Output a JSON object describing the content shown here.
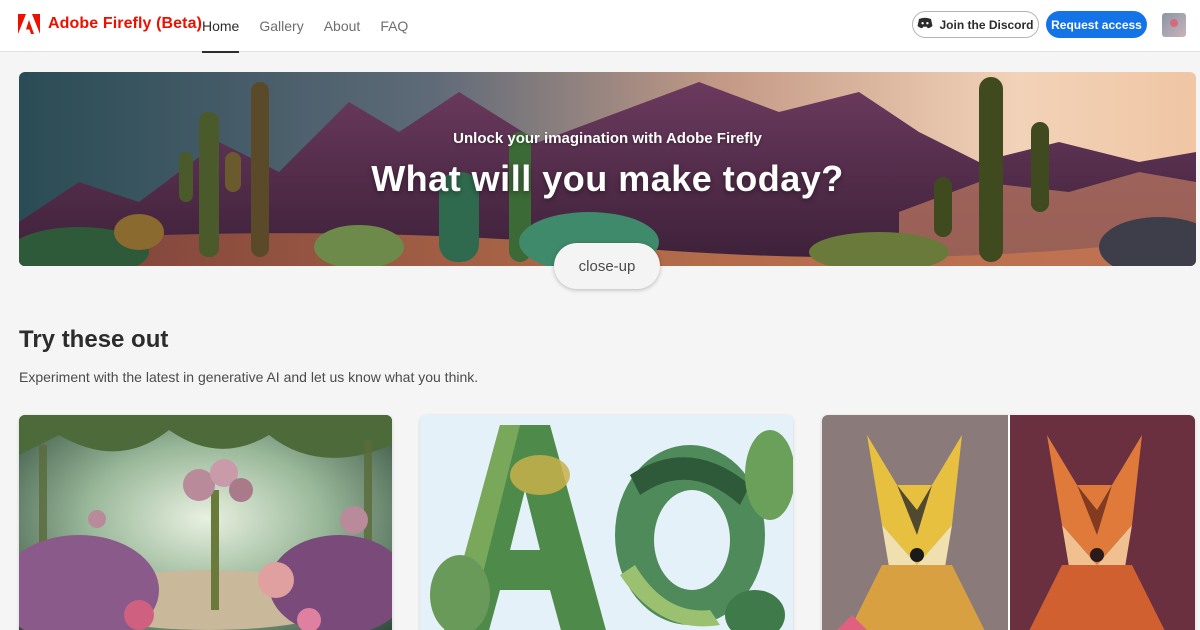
{
  "app": {
    "brand": "Adobe Firefly (Beta)",
    "brand_color": "#eb1000"
  },
  "nav": {
    "tabs": [
      {
        "label": "Home",
        "active": true
      },
      {
        "label": "Gallery",
        "active": false
      },
      {
        "label": "About",
        "active": false
      },
      {
        "label": "FAQ",
        "active": false
      }
    ]
  },
  "header_actions": {
    "discord_label": "Join the Discord",
    "discord_icon": "discord-icon",
    "request_label": "Request access",
    "accent_color": "#1473e6"
  },
  "hero": {
    "subtitle": "Unlock your imagination with Adobe Firefly",
    "title": "What will you make today?",
    "prompt_chip": "close-up"
  },
  "section": {
    "title": "Try these out",
    "description": "Experiment with the latest in generative AI and let us know what you think."
  }
}
